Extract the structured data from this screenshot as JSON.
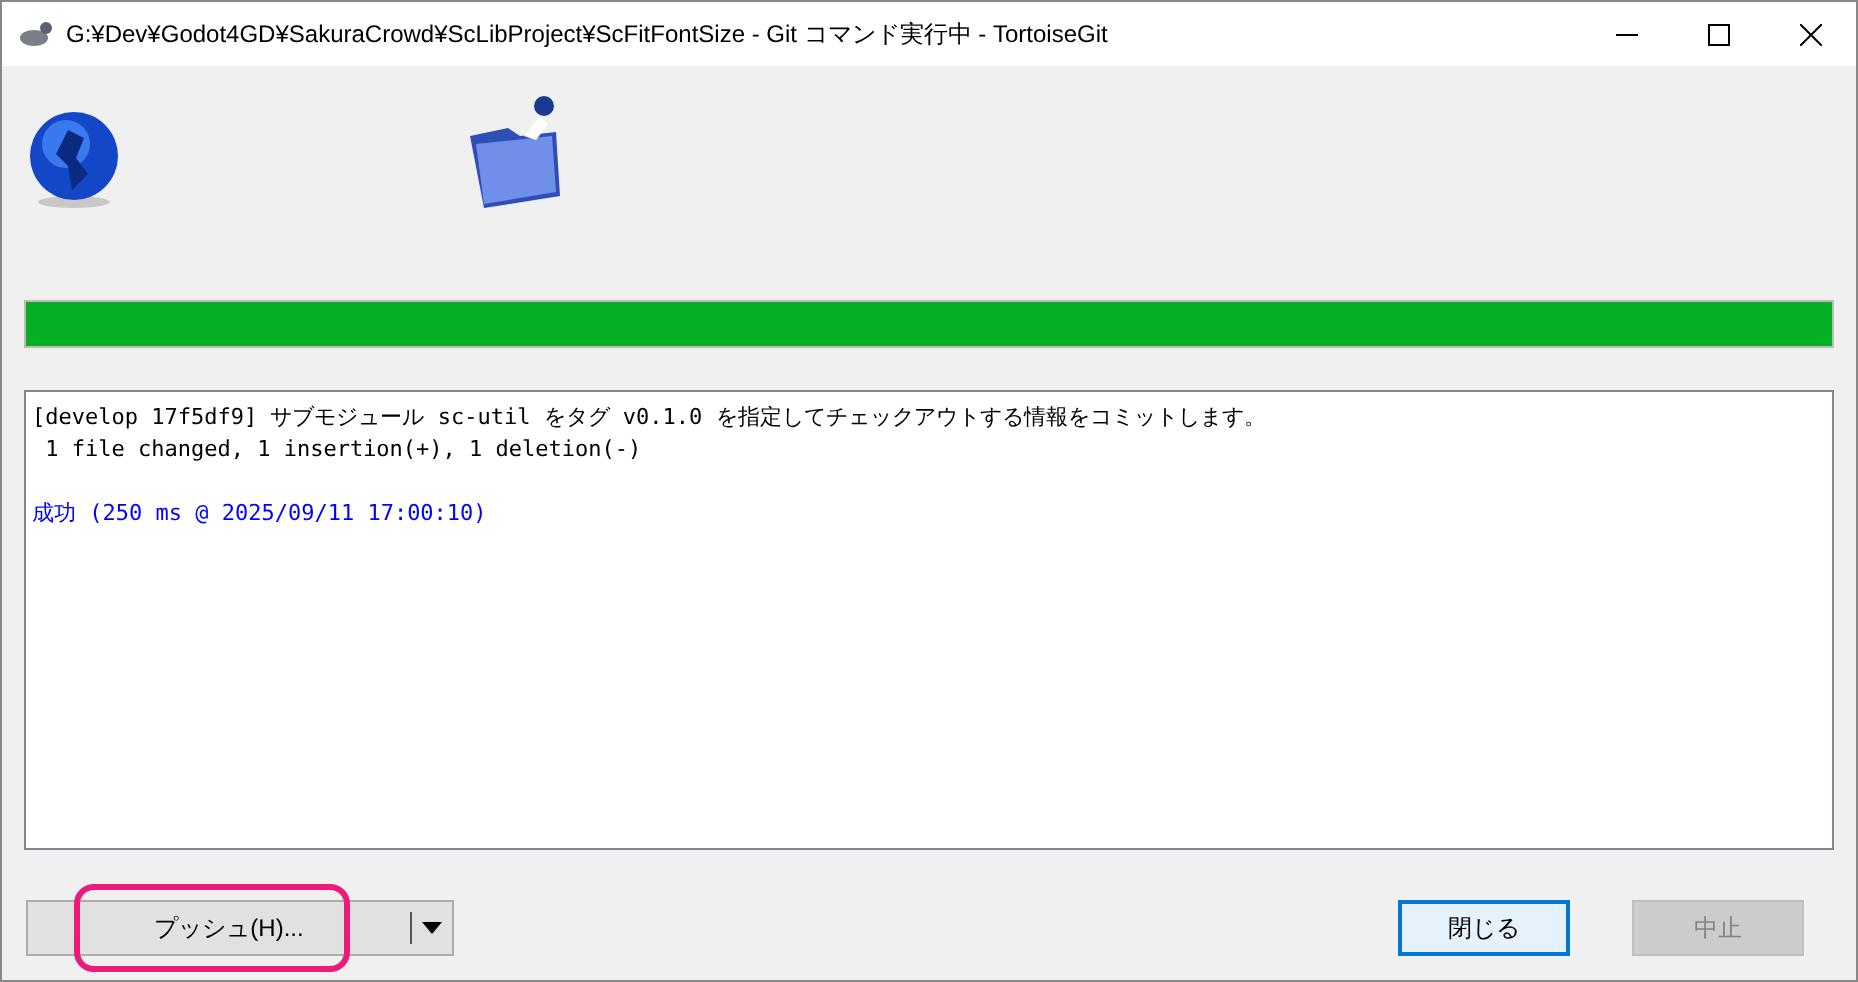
{
  "window": {
    "title": "G:¥Dev¥Godot4GD¥SakuraCrowd¥ScLibProject¥ScFitFontSize - Git コマンド実行中 - TortoiseGit"
  },
  "progress": {
    "level": 1
  },
  "log": [
    {
      "kind": "normal",
      "text": "[develop 17f5df9] サブモジュール sc-util をタグ v0.1.0 を指定してチェックアウトする情報をコミットします。"
    },
    {
      "kind": "normal",
      "text": " 1 file changed, 1 insertion(+), 1 deletion(-)"
    },
    {
      "kind": "blank"
    },
    {
      "kind": "success",
      "text": "成功 (250 ms @ 2025/09/11 17:00:10)"
    }
  ],
  "buttons": {
    "push": {
      "label": "プッシュ(H)...",
      "highlighted": true
    },
    "close": {
      "label": "閉じる",
      "disabled": false
    },
    "abort": {
      "label": "中止",
      "disabled": true
    }
  }
}
